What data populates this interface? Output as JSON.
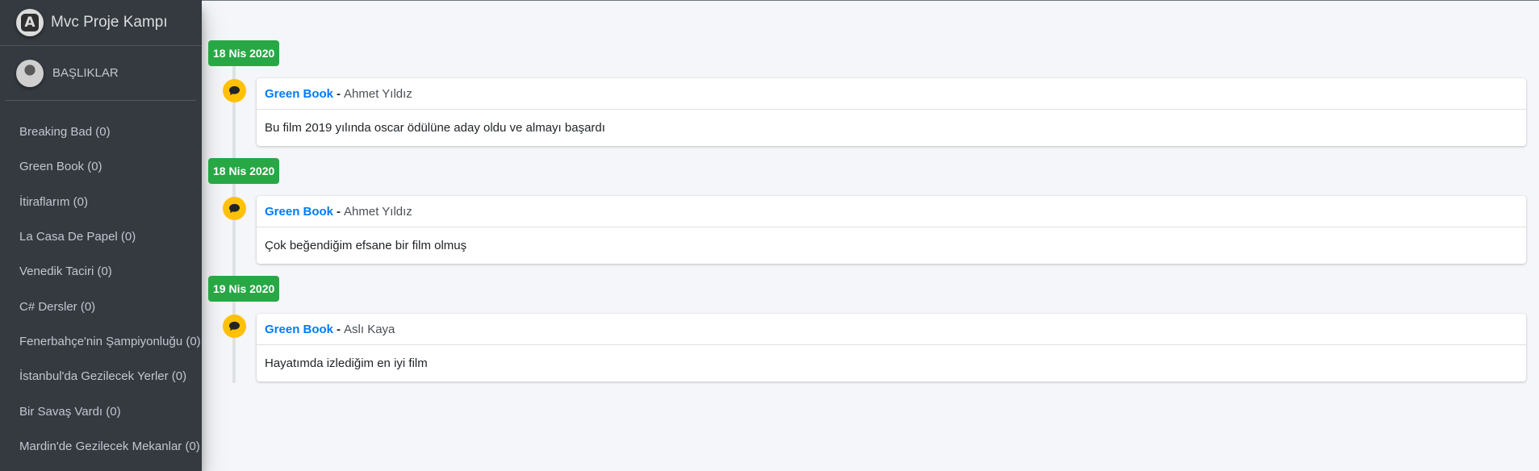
{
  "brand": {
    "title": "Mvc Proje Kampı"
  },
  "user_panel": {
    "title": "BAŞLIKLAR"
  },
  "sidebar": {
    "items": [
      {
        "label": "Breaking Bad (0)"
      },
      {
        "label": "Green Book (0)"
      },
      {
        "label": "İtiraflarım (0)"
      },
      {
        "label": "La Casa De Papel (0)"
      },
      {
        "label": "Venedik Taciri (0)"
      },
      {
        "label": "C# Dersler (0)"
      },
      {
        "label": "Fenerbahçe'nin Şampiyonluğu (0)"
      },
      {
        "label": "İstanbul'da Gezilecek Yerler (0)"
      },
      {
        "label": "Bir Savaş Vardı (0)"
      },
      {
        "label": "Mardin'de Gezilecek Mekanlar (0)"
      }
    ]
  },
  "timeline": {
    "icon": "comment-icon",
    "accent_color": "#28a745",
    "icon_color": "#ffc107",
    "entries": [
      {
        "date": "18 Nis 2020",
        "title": "Green Book",
        "separator": "-",
        "author": "Ahmet Yıldız",
        "text": "Bu film 2019 yılında oscar ödülüne aday oldu ve almayı başardı"
      },
      {
        "date": "18 Nis 2020",
        "title": "Green Book",
        "separator": "-",
        "author": "Ahmet Yıldız",
        "text": "Çok beğendiğim efsane bir film olmuş"
      },
      {
        "date": "19 Nis 2020",
        "title": "Green Book",
        "separator": "-",
        "author": "Aslı Kaya",
        "text": "Hayatımda izlediğim en iyi film"
      }
    ]
  }
}
